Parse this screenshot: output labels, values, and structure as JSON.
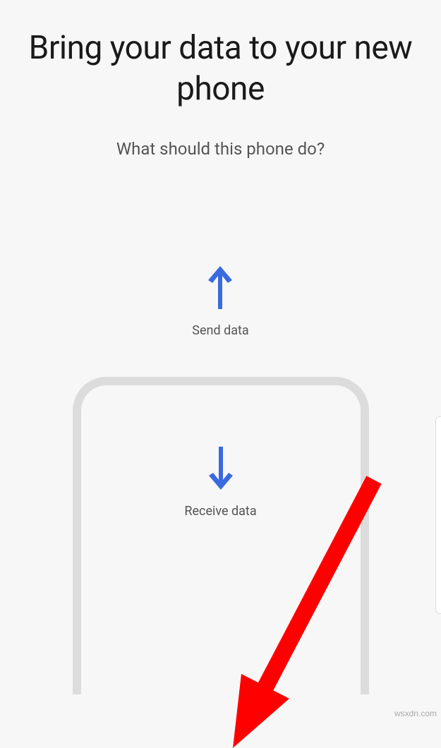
{
  "header": {
    "title": "Bring your data to your new phone",
    "subtitle": "What should this phone do?"
  },
  "options": {
    "send": {
      "label": "Send data"
    },
    "receive": {
      "label": "Receive data"
    }
  },
  "colors": {
    "arrow_blue": "#3a6ae0",
    "annotation_red": "#ff0000"
  },
  "watermark": "wsxdn.com"
}
